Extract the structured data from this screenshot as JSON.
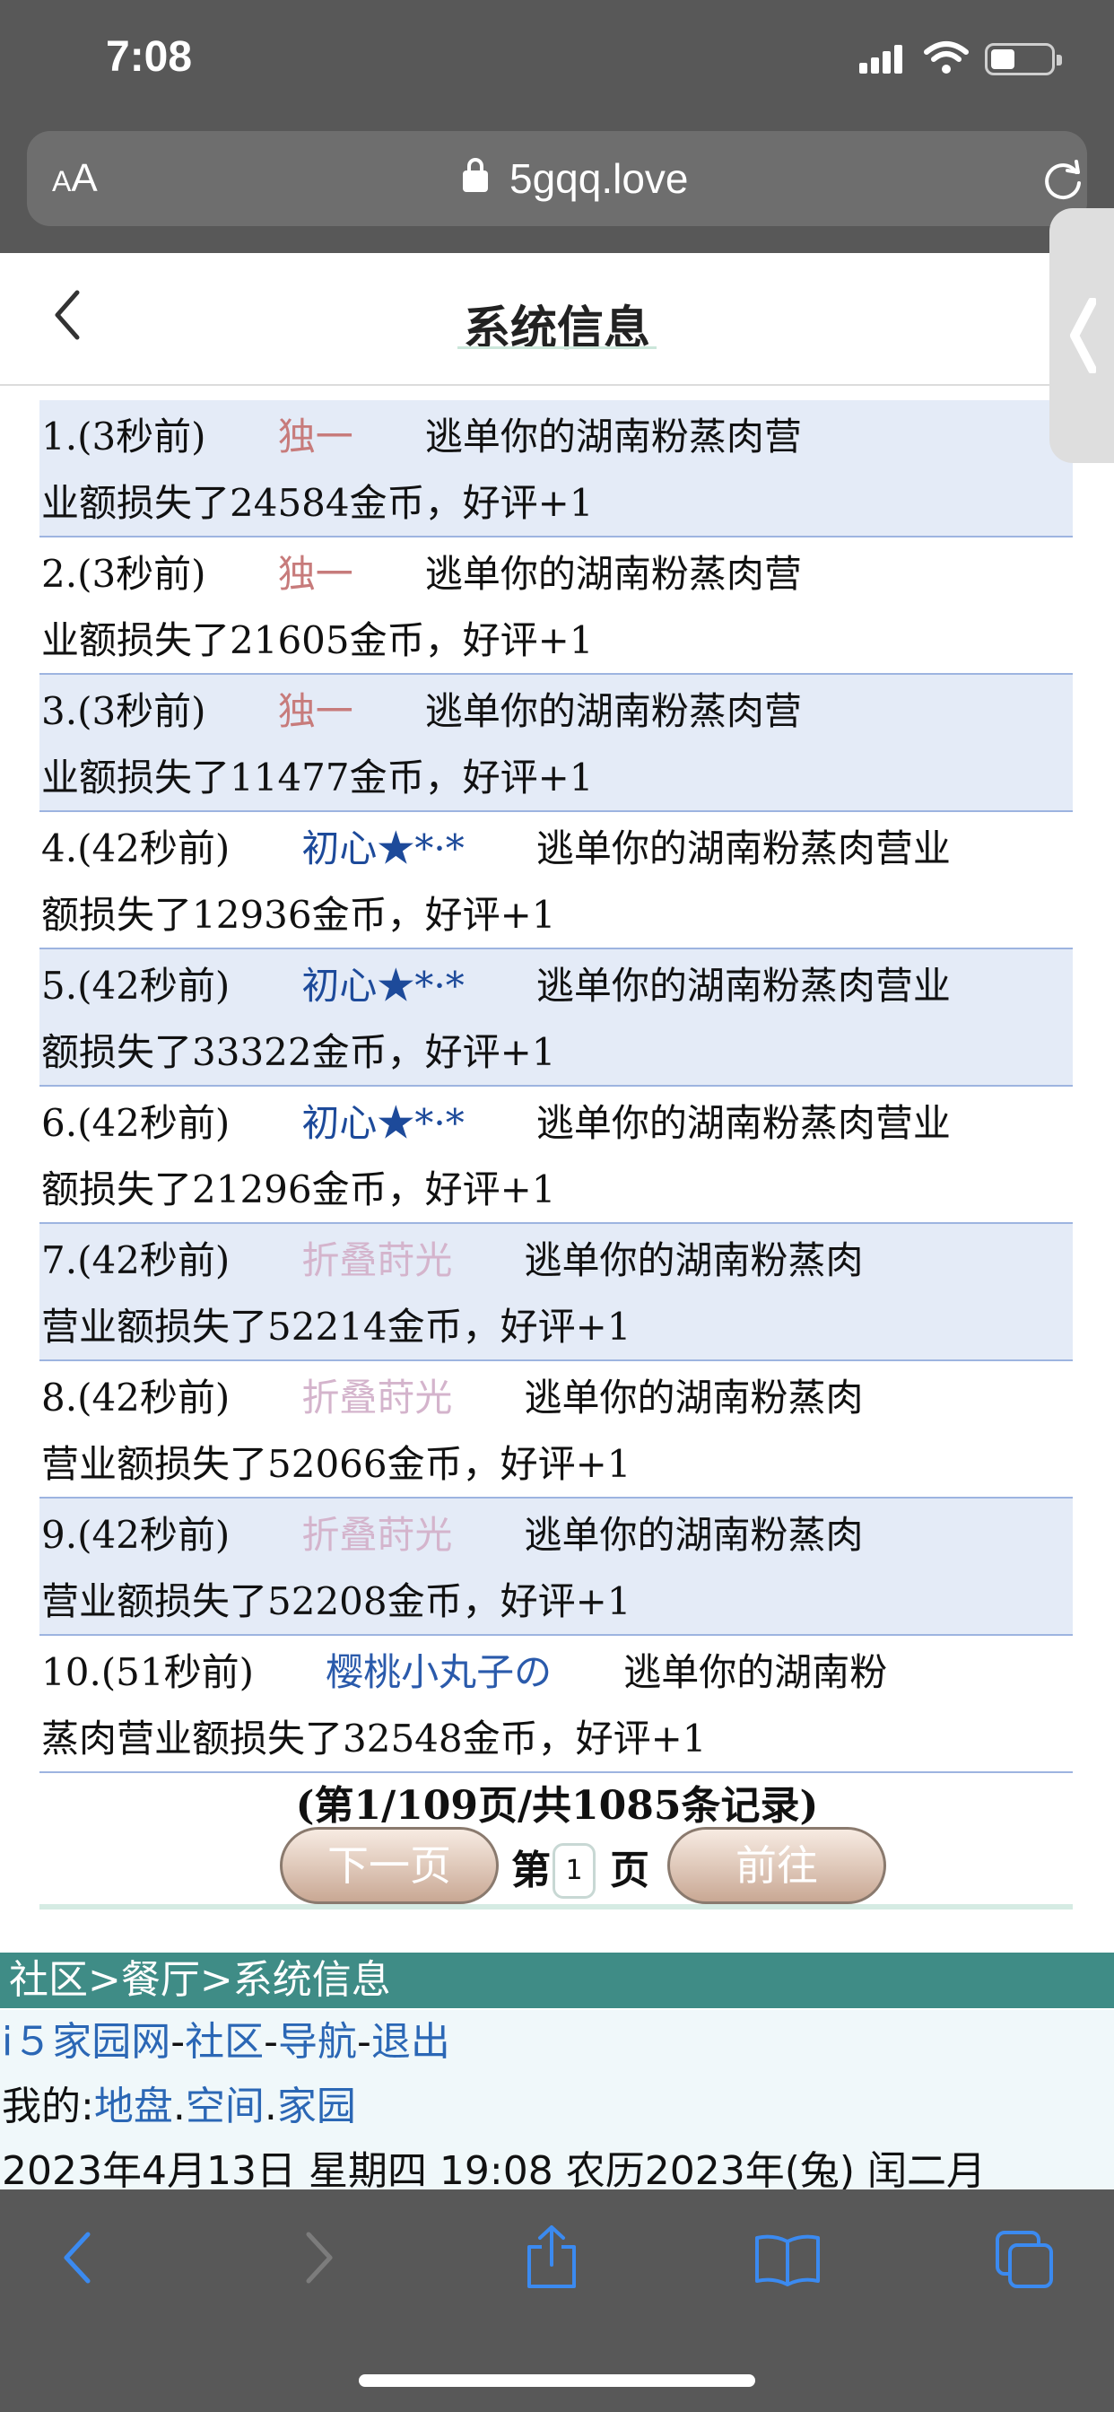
{
  "status_bar": {
    "time": "7:08"
  },
  "browser": {
    "aa_label_small": "A",
    "aa_label_large": "A",
    "url": "5gqq.love"
  },
  "header": {
    "title": "系统信息"
  },
  "messages": [
    {
      "prefix": "1.(3秒前)",
      "user": "独一",
      "text": "逃单你的湖南粉蒸肉营",
      "text2": "业额损失了24584金币，好评+1",
      "color": "c1"
    },
    {
      "prefix": "2.(3秒前)",
      "user": "独一",
      "text": "逃单你的湖南粉蒸肉营",
      "text2": "业额损失了21605金币，好评+1",
      "color": "c1"
    },
    {
      "prefix": "3.(3秒前)",
      "user": "独一",
      "text": "逃单你的湖南粉蒸肉营",
      "text2": "业额损失了11477金币，好评+1",
      "color": "c1"
    },
    {
      "prefix": "4.(42秒前)",
      "user": "初心★*·*",
      "text": "逃单你的湖南粉蒸肉营业",
      "text2": "额损失了12936金币，好评+1",
      "color": "c2"
    },
    {
      "prefix": "5.(42秒前)",
      "user": "初心★*·*",
      "text": "逃单你的湖南粉蒸肉营业",
      "text2": "额损失了33322金币，好评+1",
      "color": "c2"
    },
    {
      "prefix": "6.(42秒前)",
      "user": "初心★*·*",
      "text": "逃单你的湖南粉蒸肉营业",
      "text2": "额损失了21296金币，好评+1",
      "color": "c2"
    },
    {
      "prefix": "7.(42秒前)",
      "user": "折叠莳光",
      "text": "逃单你的湖南粉蒸肉",
      "text2": "营业额损失了52214金币，好评+1",
      "color": "c3"
    },
    {
      "prefix": "8.(42秒前)",
      "user": "折叠莳光",
      "text": "逃单你的湖南粉蒸肉",
      "text2": "营业额损失了52066金币，好评+1",
      "color": "c3"
    },
    {
      "prefix": "9.(42秒前)",
      "user": "折叠莳光",
      "text": "逃单你的湖南粉蒸肉",
      "text2": "营业额损失了52208金币，好评+1",
      "color": "c3"
    },
    {
      "prefix": "10.(51秒前)",
      "user": "樱桃小丸子の",
      "text": "逃单你的湖南粉",
      "text2": "蒸肉营业额损失了32548金币，好评+1",
      "color": "c4"
    }
  ],
  "pager": {
    "info": "(第1/109页/共1085条记录)",
    "next_label": "下一页",
    "page_prefix": "第",
    "page_value": "1",
    "page_suffix": "页",
    "go_label": "前往"
  },
  "footer": {
    "breadcrumb": "社区>餐厅>系统信息",
    "nav": {
      "i5": "i５家园网",
      "sep": "-",
      "community": "社区",
      "navigation": "导航",
      "logout": "退出"
    },
    "mine": {
      "label": "我的:",
      "territory": "地盘",
      "dot": ".",
      "space": "空间",
      "home": "家园"
    },
    "date_line": "2023年4月13日 星期四 19:08 农历2023年(兔) 闰二月"
  },
  "colors": {
    "chrome": "#585858",
    "row_shade": "#e4ebf7",
    "breadcrumb_bg": "#3f8c86",
    "link": "#2b67b5"
  }
}
